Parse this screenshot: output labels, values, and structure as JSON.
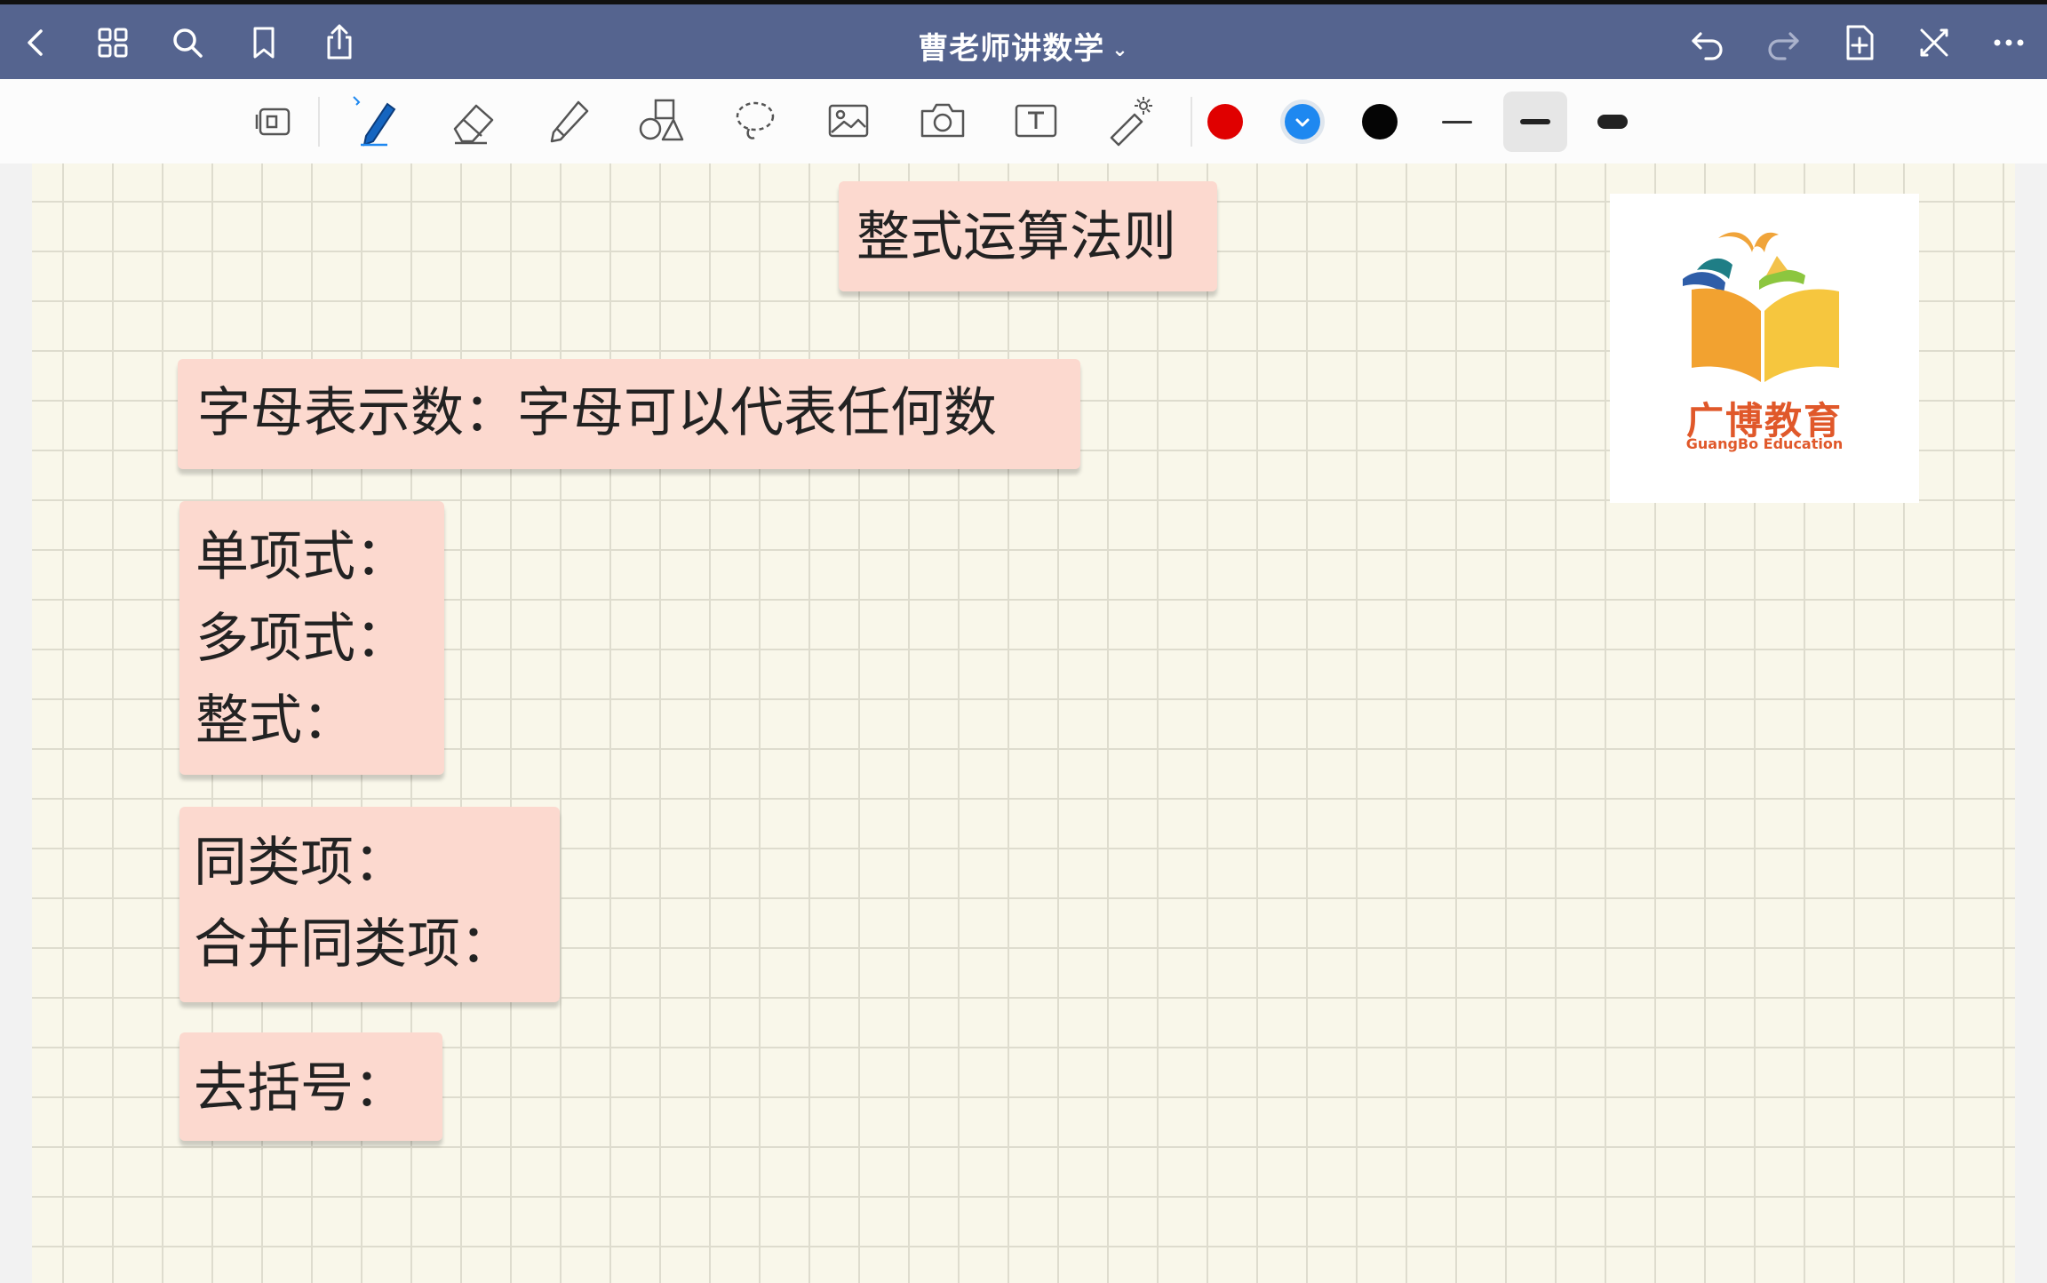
{
  "app": {
    "doc_title": "曹老师讲数学",
    "title_chevron": "⌄"
  },
  "toolbar": {
    "colors": [
      "#e00000",
      "#1e88f0",
      "#050505"
    ],
    "selected_color_index": 1,
    "selected_width_index": 1
  },
  "canvas": {
    "title_note": "整式运算法则",
    "definition_note": "字母表示数：字母可以代表任何数",
    "terms_note": [
      "单项式：",
      "多项式：",
      "整式："
    ],
    "like_terms_note": [
      "同类项：",
      "合并同类项："
    ],
    "brackets_note": "去括号："
  },
  "logo": {
    "name": "广博教育",
    "subtitle": "GuangBo Education",
    "brand_color": "#e0582a"
  }
}
